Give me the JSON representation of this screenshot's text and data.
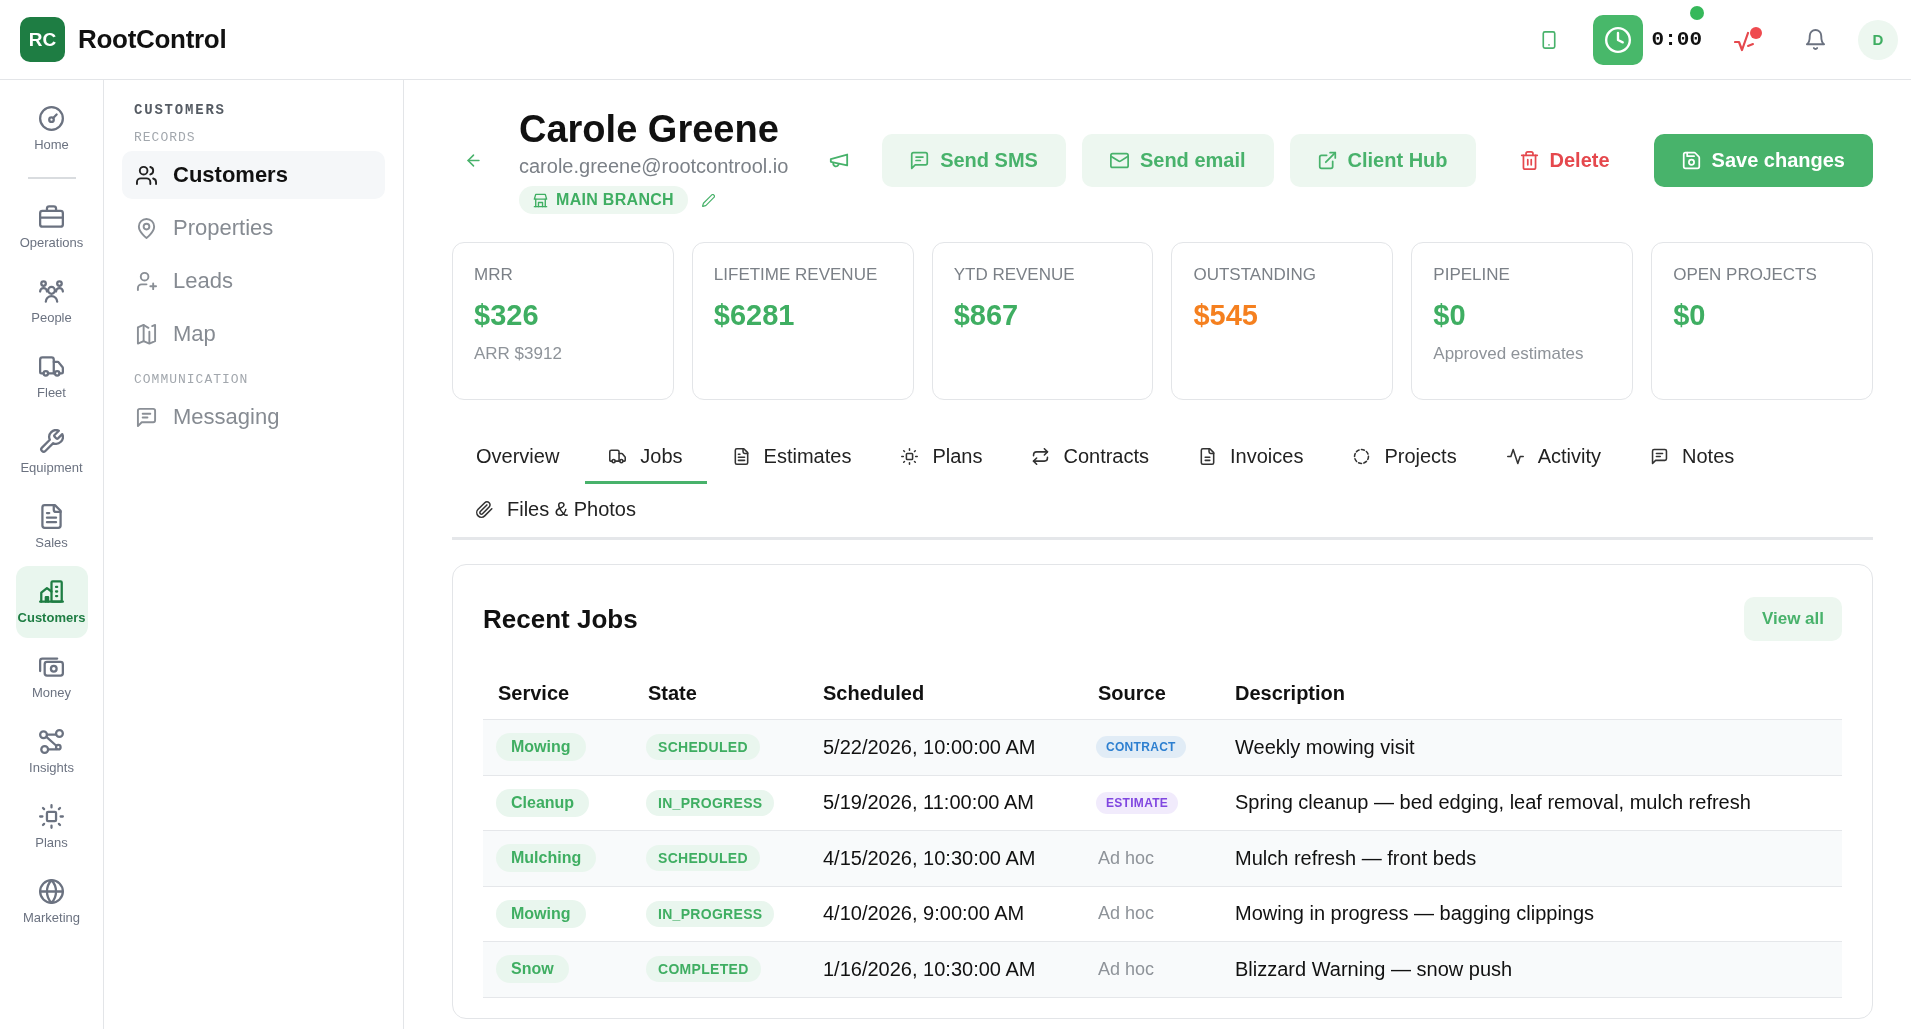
{
  "app": {
    "logo": "RC",
    "name": "RootControl"
  },
  "topbar": {
    "timer": "0:00",
    "avatar": "D"
  },
  "rail": [
    {
      "items": [
        {
          "label": "Home",
          "selected": false
        }
      ]
    },
    {
      "items": [
        {
          "label": "Operations",
          "selected": false
        },
        {
          "label": "People",
          "selected": false
        },
        {
          "label": "Fleet",
          "selected": false
        },
        {
          "label": "Equipment",
          "selected": false
        },
        {
          "label": "Sales",
          "selected": false
        },
        {
          "label": "Customers",
          "selected": true
        },
        {
          "label": "Money",
          "selected": false
        },
        {
          "label": "Insights",
          "selected": false
        },
        {
          "label": "Plans",
          "selected": false
        },
        {
          "label": "Marketing",
          "selected": false
        }
      ]
    }
  ],
  "sidebar": {
    "title": "CUSTOMERS",
    "sections": [
      {
        "heading": "RECORDS",
        "items": [
          {
            "label": "Customers",
            "selected": true
          },
          {
            "label": "Properties",
            "selected": false
          },
          {
            "label": "Leads",
            "selected": false
          },
          {
            "label": "Map",
            "selected": false
          }
        ]
      },
      {
        "heading": "COMMUNICATION",
        "items": [
          {
            "label": "Messaging",
            "selected": false
          }
        ]
      }
    ]
  },
  "customer": {
    "name": "Carole Greene",
    "email": "carole.greene@rootcontrool.io",
    "branch": "MAIN BRANCH"
  },
  "actions": [
    {
      "label": "Send SMS",
      "kind": "soft"
    },
    {
      "label": "Send email",
      "kind": "soft"
    },
    {
      "label": "Client Hub",
      "kind": "soft"
    },
    {
      "label": "Delete",
      "kind": "danger"
    },
    {
      "label": "Save changes",
      "kind": "primary"
    }
  ],
  "stats": [
    {
      "label": "MRR",
      "value": "$326",
      "color": "#3fae62",
      "note": "ARR $3912"
    },
    {
      "label": "LIFETIME REVENUE",
      "value": "$6281",
      "color": "#3fae62"
    },
    {
      "label": "YTD REVENUE",
      "value": "$867",
      "color": "#3fae62"
    },
    {
      "label": "OUTSTANDING",
      "value": "$545",
      "color": "#f5801f"
    },
    {
      "label": "PIPELINE",
      "value": "$0",
      "color": "#3fae62",
      "note": "Approved estimates"
    },
    {
      "label": "OPEN PROJECTS",
      "value": "$0",
      "color": "#3fae62"
    }
  ],
  "tabs": [
    {
      "label": "Overview",
      "selected": false
    },
    {
      "label": "Jobs",
      "selected": true
    },
    {
      "label": "Estimates",
      "selected": false
    },
    {
      "label": "Plans",
      "selected": false
    },
    {
      "label": "Contracts",
      "selected": false
    },
    {
      "label": "Invoices",
      "selected": false
    },
    {
      "label": "Projects",
      "selected": false
    },
    {
      "label": "Activity",
      "selected": false
    },
    {
      "label": "Notes",
      "selected": false
    },
    {
      "label": "Files & Photos",
      "selected": false
    }
  ],
  "recent_jobs": {
    "title": "Recent Jobs",
    "view_all": "View all",
    "columns": [
      "Service",
      "State",
      "Scheduled",
      "Source",
      "Description"
    ],
    "rows": [
      {
        "service": "Mowing",
        "state": "SCHEDULED",
        "scheduled": "5/22/2026, 10:00:00 AM",
        "source": {
          "kind": "badge",
          "label": "CONTRACT",
          "color": "#2d7fd0"
        },
        "description": "Weekly mowing visit"
      },
      {
        "service": "Cleanup",
        "state": "IN_PROGRESS",
        "scheduled": "5/19/2026, 11:00:00 AM",
        "source": {
          "kind": "badge",
          "label": "ESTIMATE",
          "color": "#8047e0"
        },
        "description": "Spring cleanup — bed edging, leaf removal, mulch refresh"
      },
      {
        "service": "Mulching",
        "state": "SCHEDULED",
        "scheduled": "4/15/2026, 10:30:00 AM",
        "source": {
          "kind": "plain",
          "label": "Ad hoc"
        },
        "description": "Mulch refresh — front beds"
      },
      {
        "service": "Mowing",
        "state": "IN_PROGRESS",
        "scheduled": "4/10/2026, 9:00:00 AM",
        "source": {
          "kind": "plain",
          "label": "Ad hoc"
        },
        "description": "Mowing in progress — bagging clippings"
      },
      {
        "service": "Snow",
        "state": "COMPLETED",
        "scheduled": "1/16/2026, 10:30:00 AM",
        "source": {
          "kind": "plain",
          "label": "Ad hoc"
        },
        "description": "Blizzard Warning — snow push"
      }
    ]
  }
}
